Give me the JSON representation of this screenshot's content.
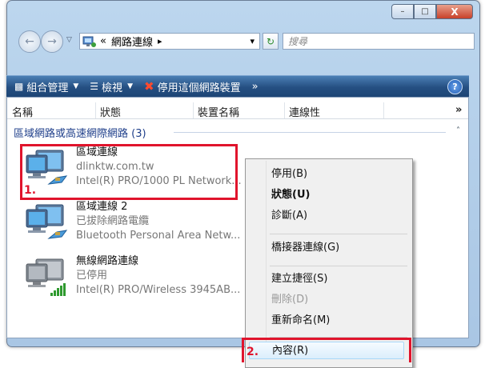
{
  "titlebar": {
    "minimize": "–",
    "maximize": "□",
    "close": "X"
  },
  "nav": {
    "back_glyph": "←",
    "forward_glyph": "→",
    "dropdown_glyph": "▽",
    "address_prefix": "«",
    "address_text": "網路連線",
    "address_arrow": "▸",
    "address_dropdown": "▾",
    "refresh_glyph": "↻",
    "search_placeholder": "搜尋"
  },
  "toolbar": {
    "organize": "組合管理",
    "views": "檢視",
    "disable": "停用這個網路裝置",
    "more": "»",
    "help": "?"
  },
  "columns": [
    "名稱",
    "狀態",
    "裝置名稱",
    "連線性"
  ],
  "columns_more": "»",
  "group": {
    "label": "區域網路或高速網際網路 (3)",
    "collapse": "˄"
  },
  "connections": [
    {
      "name": "區域連線",
      "status": "dlinktw.com.tw",
      "device": "Intel(R) PRO/1000 PL Network..."
    },
    {
      "name": "區域連線 2",
      "status": "已拔除網路電纜",
      "device": "Bluetooth Personal Area Netw..."
    },
    {
      "name": "無線網路連線",
      "status": "已停用",
      "device": "Intel(R) PRO/Wireless 3945AB..."
    }
  ],
  "context_menu": {
    "disable": "停用(B)",
    "status": "狀態(U)",
    "diagnose": "診斷(A)",
    "bridge": "橋接器連線(G)",
    "shortcut": "建立捷徑(S)",
    "delete": "刪除(D)",
    "rename": "重新命名(M)",
    "properties": "內容(R)"
  },
  "annotations": {
    "step1": "1.",
    "step2": "2."
  },
  "colors": {
    "highlight_red": "#e0142c",
    "toolbar_blue": "#254f82"
  }
}
